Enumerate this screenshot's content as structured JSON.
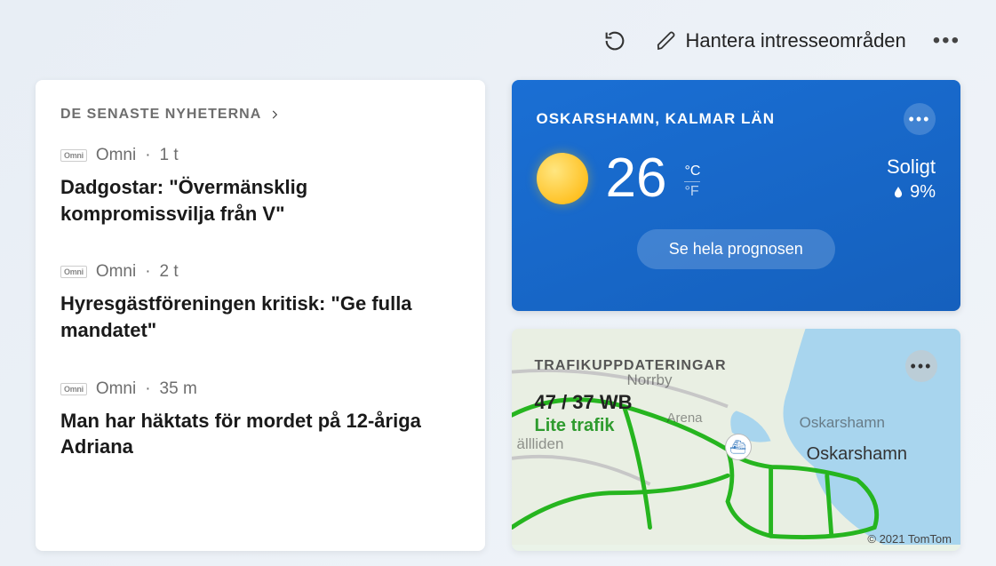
{
  "header": {
    "manage_label": "Hantera intresseområden"
  },
  "news": {
    "section_title": "DE SENASTE NYHETERNA",
    "items": [
      {
        "source": "Omni",
        "time": "1 t",
        "logo": "Omni",
        "title": "Dadgostar: \"Övermänsklig kompromissvilja från V\""
      },
      {
        "source": "Omni",
        "time": "2 t",
        "logo": "Omni",
        "title": "Hyresgästföreningen kritisk: \"Ge fulla mandatet\""
      },
      {
        "source": "Omni",
        "time": "35 m",
        "logo": "Omni",
        "title": "Man har häktats för mordet på 12-åriga Adriana"
      }
    ]
  },
  "weather": {
    "location": "OSKARSHAMN, KALMAR LÄN",
    "temp": "26",
    "unit_c": "°C",
    "unit_f": "°F",
    "condition": "Soligt",
    "precip": "9%",
    "forecast_button": "Se hela prognosen"
  },
  "traffic": {
    "title": "TRAFIKUPPDATERINGAR",
    "route": "47 / 37 WB",
    "status": "Lite trafik",
    "labels": {
      "norrby": "Norrby",
      "oskarshamn": "Oskarshamn",
      "tallliden": "ällliden",
      "arena": "Arena",
      "oskarshamn2": "Oskarshamn"
    },
    "attribution": "© 2021 TomTom"
  }
}
